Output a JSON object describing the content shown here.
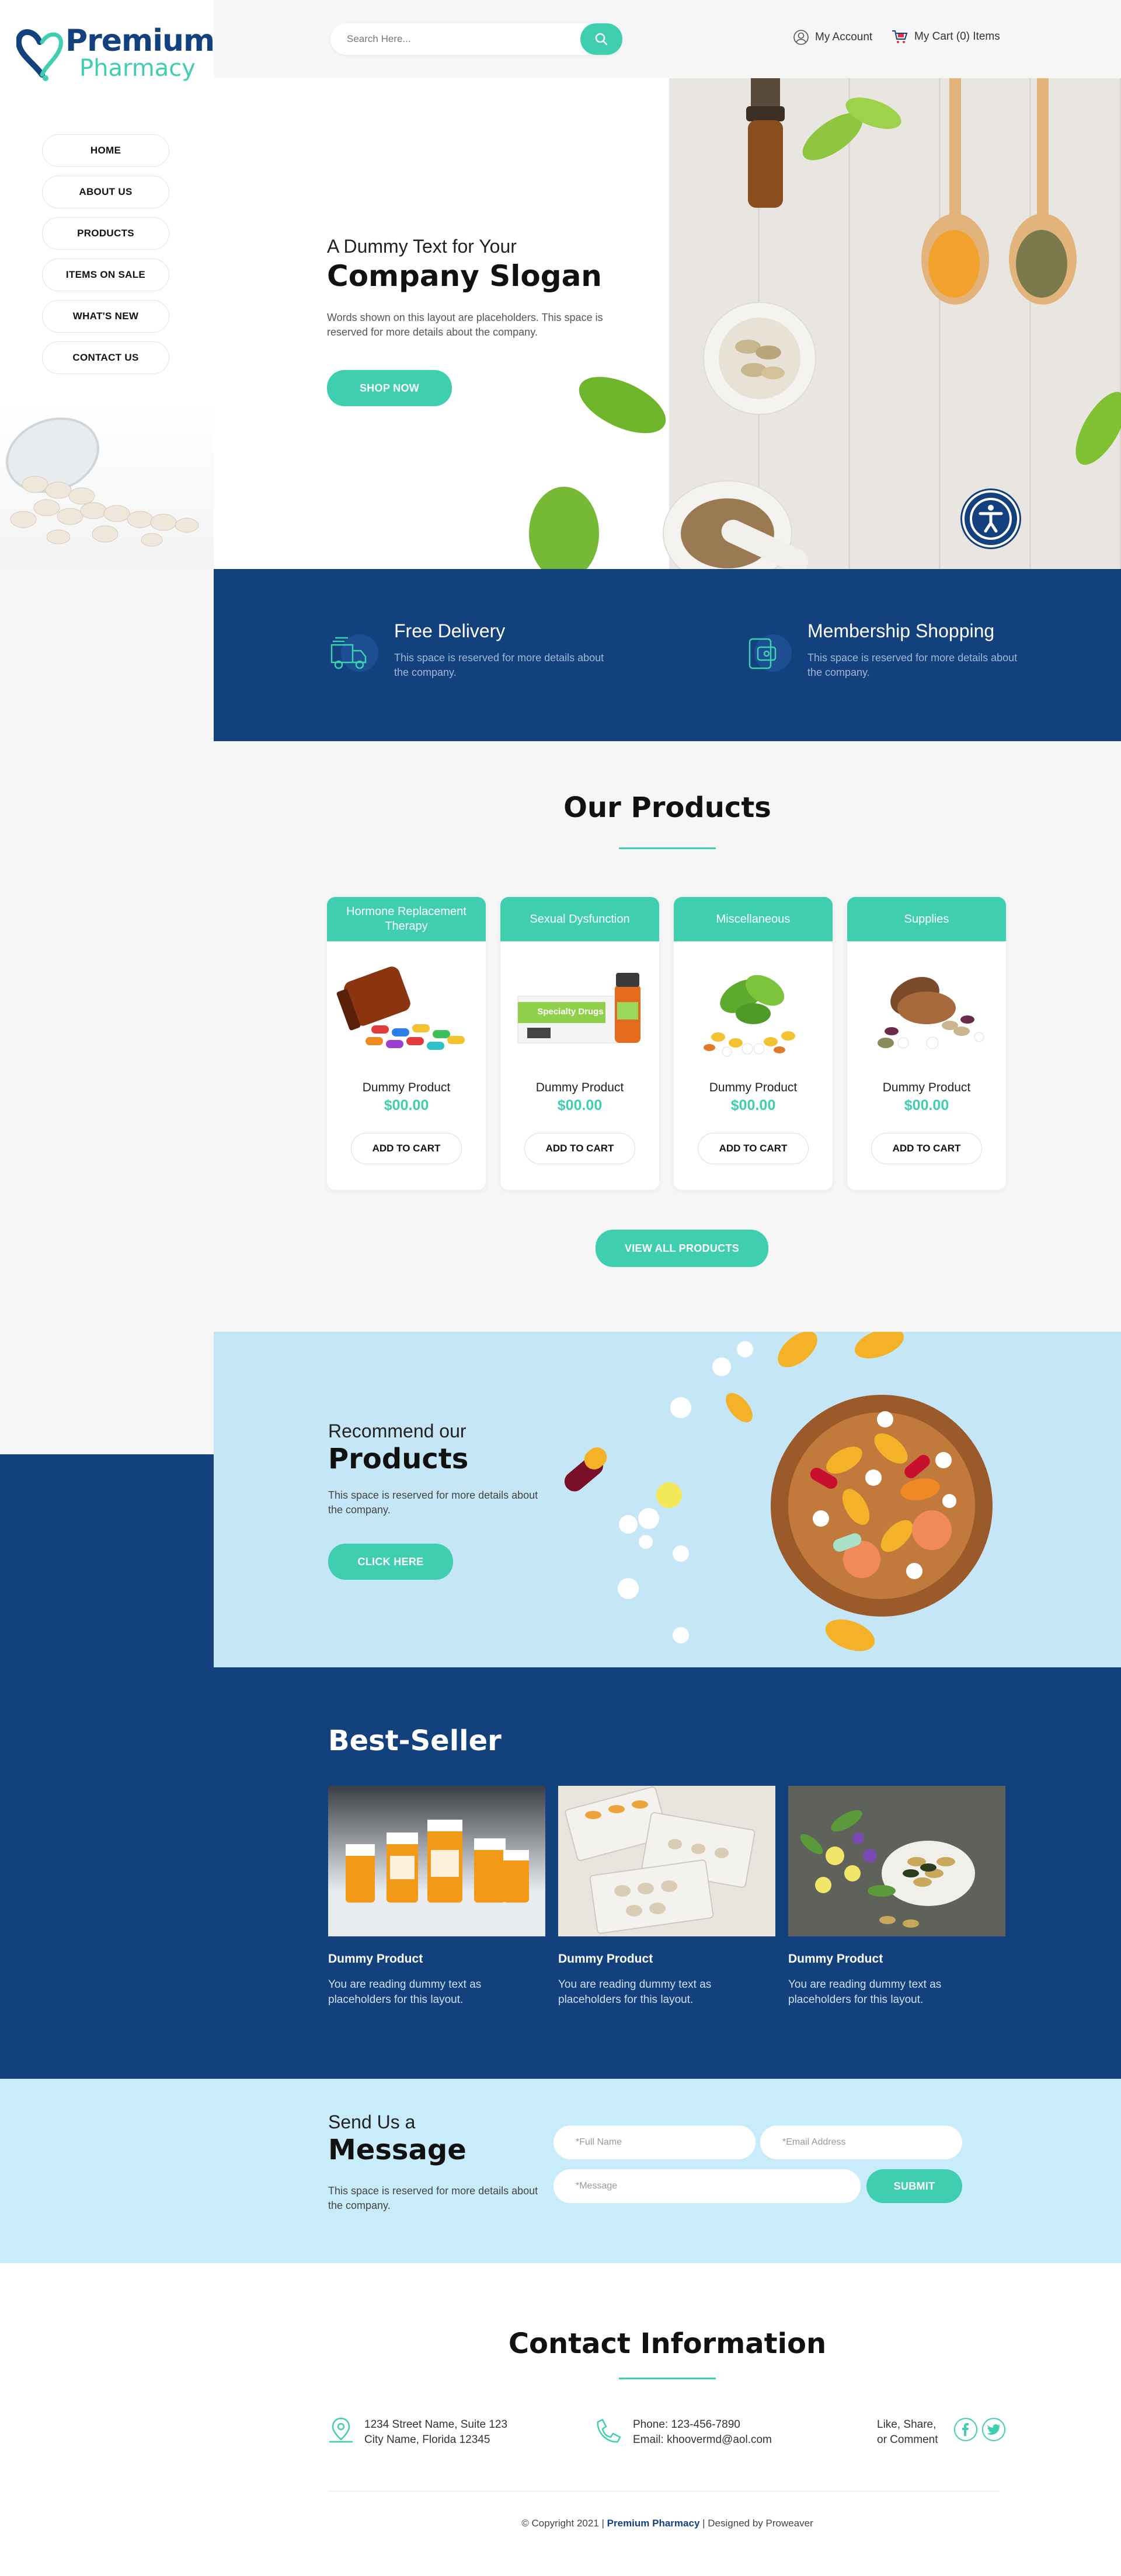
{
  "brand": {
    "name_line1": "Premium",
    "name_line2": "Pharmacy"
  },
  "nav": {
    "items": [
      "HOME",
      "ABOUT US",
      "PRODUCTS",
      "ITEMS ON SALE",
      "WHAT'S NEW",
      "CONTACT US"
    ]
  },
  "header": {
    "search_placeholder": "Search Here...",
    "account_label": "My Account",
    "cart_label": "My Cart (0) Items"
  },
  "hero": {
    "pretitle": "A Dummy Text for Your",
    "title": "Company Slogan",
    "text": "Words shown on this layout are placeholders. This space is reserved for more details about the company.",
    "button": "SHOP NOW"
  },
  "features": [
    {
      "title": "Free Delivery",
      "text": "This space is reserved for more details about the company.",
      "icon": "delivery-truck-icon"
    },
    {
      "title": "Membership Shopping",
      "text": "This space is reserved for more details about the company.",
      "icon": "membership-card-icon"
    }
  ],
  "products": {
    "title": "Our Products",
    "cards": [
      {
        "category": "Hormone Replacement Therapy",
        "name": "Dummy Product",
        "price": "$00.00",
        "button": "ADD TO CART"
      },
      {
        "category": "Sexual Dysfunction",
        "name": "Dummy Product",
        "price": "$00.00",
        "button": "ADD TO CART",
        "box_label": "Specialty Drugs"
      },
      {
        "category": "Miscellaneous",
        "name": "Dummy Product",
        "price": "$00.00",
        "button": "ADD TO CART"
      },
      {
        "category": "Supplies",
        "name": "Dummy Product",
        "price": "$00.00",
        "button": "ADD TO CART"
      }
    ],
    "view_all": "VIEW ALL PRODUCTS"
  },
  "recommend": {
    "pretitle": "Recommend our",
    "title": "Products",
    "text": "This space is reserved for more details about the company.",
    "button": "CLICK HERE"
  },
  "bestseller": {
    "title": "Best-Seller",
    "items": [
      {
        "name": "Dummy Product",
        "text": "You are reading dummy text as placeholders for this layout."
      },
      {
        "name": "Dummy Product",
        "text": "You are reading dummy text as placeholders for this layout."
      },
      {
        "name": "Dummy Product",
        "text": "You are reading dummy text as placeholders for this layout."
      }
    ]
  },
  "message": {
    "pretitle": "Send Us a",
    "title": "Message",
    "text": "This space is reserved for more details about the company.",
    "full_name_placeholder": "*Full Name",
    "email_placeholder": "*Email Address",
    "message_placeholder": "*Message",
    "submit": "SUBMIT"
  },
  "contact": {
    "title": "Contact Information",
    "address_line1": "1234 Street Name, Suite 123",
    "address_line2": "City Name, Florida 12345",
    "phone": "Phone: 123-456-7890",
    "email": "Email: khoovermd@aol.com",
    "social_line1": "Like, Share,",
    "social_line2": "or Comment"
  },
  "footer": {
    "prefix": "© Copyright 2021 |",
    "brand": "Premium Pharmacy",
    "suffix": "| Designed by Proweaver"
  },
  "colors": {
    "navy": "#13417e",
    "teal": "#3fcfb0",
    "light_blue": "#c9ecfa"
  }
}
